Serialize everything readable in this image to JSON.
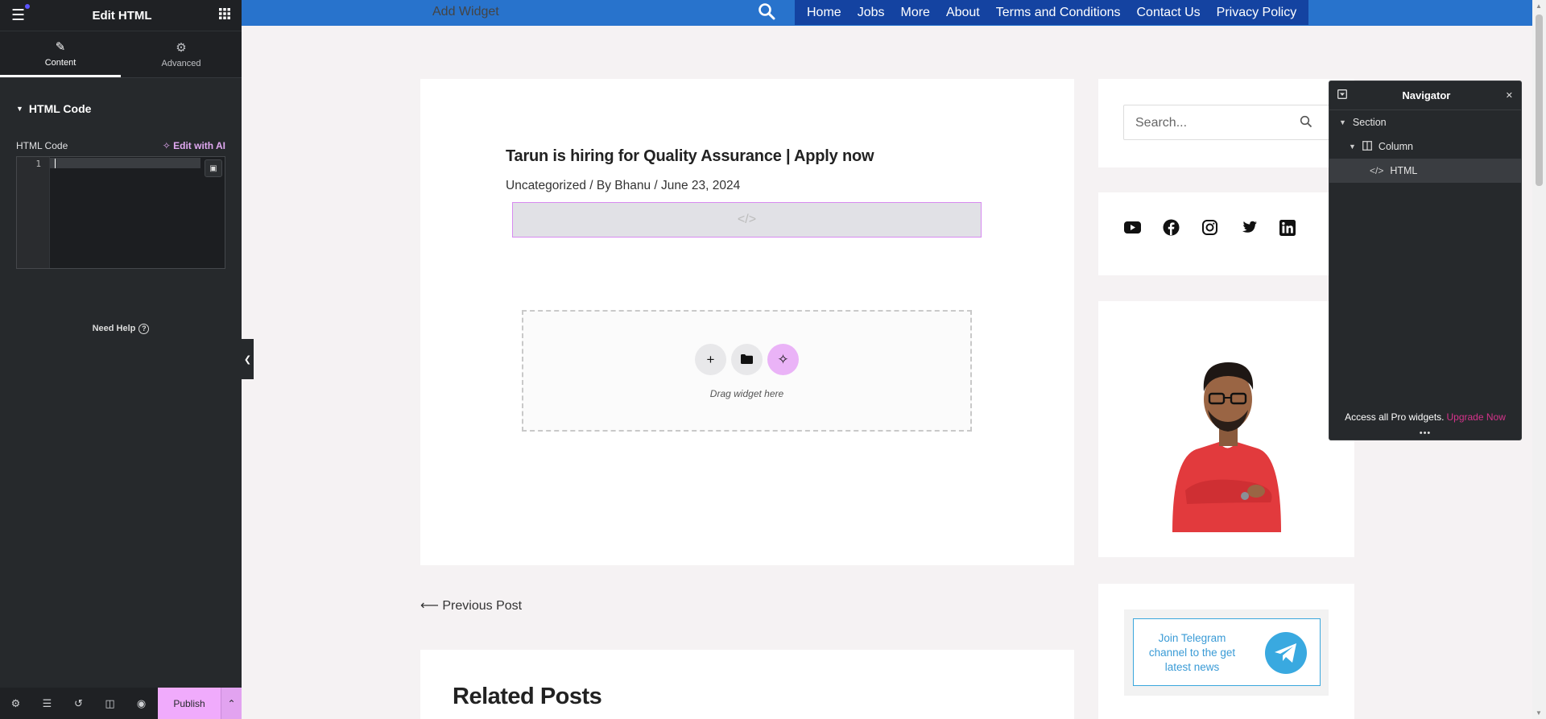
{
  "panel": {
    "title": "Edit HTML",
    "tabs": [
      {
        "label": "Content",
        "icon": "pencil-icon"
      },
      {
        "label": "Advanced",
        "icon": "gear-icon"
      }
    ],
    "section_title": "HTML Code",
    "control_label": "HTML Code",
    "edit_with_ai": "Edit with AI",
    "code_line": "1",
    "need_help": "Need Help",
    "footer": {
      "publish": "Publish"
    }
  },
  "topnav": {
    "add_widget": "Add Widget",
    "menu": [
      "Home",
      "Jobs",
      "More",
      "About",
      "Terms and Conditions",
      "Contact Us",
      "Privacy Policy"
    ],
    "colors": {
      "bar": "#2873cc",
      "menu_bg": "#1443a1"
    }
  },
  "article": {
    "title": "Tarun is hiring for Quality Assurance | Apply now",
    "meta": "Uncategorized / By Bhanu / June 23, 2024",
    "drop_hint": "Drag widget here"
  },
  "prev_post": "⟵ Previous Post",
  "related_posts": "Related Posts",
  "sidebar": {
    "search_placeholder": "Search...",
    "social": [
      "youtube-icon",
      "facebook-icon",
      "instagram-icon",
      "twitter-icon",
      "linkedin-icon"
    ],
    "telegram_text": "Join Telegram channel to the get latest news"
  },
  "navigator": {
    "title": "Navigator",
    "items": [
      {
        "label": "Section"
      },
      {
        "label": "Column"
      },
      {
        "label": "HTML"
      }
    ],
    "promo_text": "Access all Pro widgets.",
    "promo_link": "Upgrade Now"
  },
  "accent_color": "#f0abfc"
}
